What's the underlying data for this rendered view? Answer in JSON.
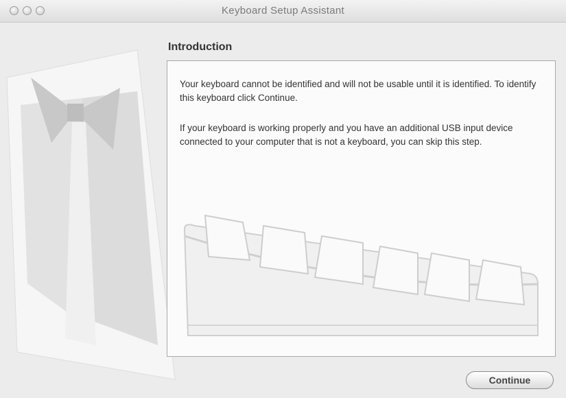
{
  "window": {
    "title": "Keyboard Setup Assistant"
  },
  "heading": "Introduction",
  "content": {
    "paragraph1": "Your keyboard cannot be identified and will not be usable until it is identified. To identify this keyboard click Continue.",
    "paragraph2": "If your keyboard is working properly and you have an additional USB input device connected to your computer that is not a keyboard, you can skip this step."
  },
  "buttons": {
    "continue_label": "Continue"
  },
  "icons": {
    "window_controls": [
      "close-icon",
      "minimize-icon",
      "zoom-icon"
    ],
    "sidebar_art": "tuxedo-illustration",
    "keyboard_art": "keyboard-illustration"
  },
  "colors": {
    "window_background": "#ececec",
    "content_background": "#fbfbfb",
    "text": "#333333"
  }
}
